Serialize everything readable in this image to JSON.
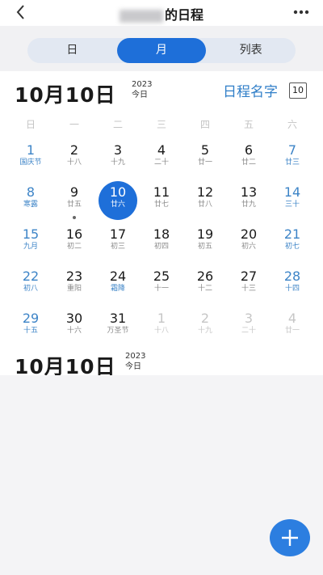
{
  "header": {
    "title_suffix": "的日程"
  },
  "tabs": [
    {
      "label": "日",
      "active": false
    },
    {
      "label": "月",
      "active": true
    },
    {
      "label": "列表",
      "active": false
    }
  ],
  "current": {
    "date": "10月10日",
    "year": "2023",
    "today": "今日"
  },
  "schedule": {
    "name": "日程名字",
    "count": "10"
  },
  "weekdays": [
    "日",
    "一",
    "二",
    "三",
    "四",
    "五",
    "六"
  ],
  "days": [
    {
      "n": "1",
      "l": "国庆节",
      "kind": "wk fest"
    },
    {
      "n": "2",
      "l": "十八",
      "kind": ""
    },
    {
      "n": "3",
      "l": "十九",
      "kind": ""
    },
    {
      "n": "4",
      "l": "二十",
      "kind": ""
    },
    {
      "n": "5",
      "l": "廿一",
      "kind": ""
    },
    {
      "n": "6",
      "l": "廿二",
      "kind": ""
    },
    {
      "n": "7",
      "l": "廿三",
      "kind": "wk"
    },
    {
      "n": "8",
      "l": "寒露",
      "kind": "wk fest"
    },
    {
      "n": "9",
      "l": "廿五",
      "kind": "dot"
    },
    {
      "n": "10",
      "l": "廿六",
      "kind": "sel"
    },
    {
      "n": "11",
      "l": "廿七",
      "kind": ""
    },
    {
      "n": "12",
      "l": "廿八",
      "kind": ""
    },
    {
      "n": "13",
      "l": "廿九",
      "kind": ""
    },
    {
      "n": "14",
      "l": "三十",
      "kind": "wk"
    },
    {
      "n": "15",
      "l": "九月",
      "kind": "wk"
    },
    {
      "n": "16",
      "l": "初二",
      "kind": ""
    },
    {
      "n": "17",
      "l": "初三",
      "kind": ""
    },
    {
      "n": "18",
      "l": "初四",
      "kind": ""
    },
    {
      "n": "19",
      "l": "初五",
      "kind": ""
    },
    {
      "n": "20",
      "l": "初六",
      "kind": ""
    },
    {
      "n": "21",
      "l": "初七",
      "kind": "wk"
    },
    {
      "n": "22",
      "l": "初八",
      "kind": "wk"
    },
    {
      "n": "23",
      "l": "重阳",
      "kind": ""
    },
    {
      "n": "24",
      "l": "霜降",
      "kind": "fest"
    },
    {
      "n": "25",
      "l": "十一",
      "kind": ""
    },
    {
      "n": "26",
      "l": "十二",
      "kind": ""
    },
    {
      "n": "27",
      "l": "十三",
      "kind": ""
    },
    {
      "n": "28",
      "l": "十四",
      "kind": "wk"
    },
    {
      "n": "29",
      "l": "十五",
      "kind": "wk"
    },
    {
      "n": "30",
      "l": "十六",
      "kind": ""
    },
    {
      "n": "31",
      "l": "万圣节",
      "kind": ""
    },
    {
      "n": "1",
      "l": "十八",
      "kind": "other"
    },
    {
      "n": "2",
      "l": "十九",
      "kind": "other"
    },
    {
      "n": "3",
      "l": "二十",
      "kind": "other"
    },
    {
      "n": "4",
      "l": "廿一",
      "kind": "other"
    }
  ],
  "list": {
    "date": "10月10日",
    "year": "2023",
    "today": "今日"
  }
}
